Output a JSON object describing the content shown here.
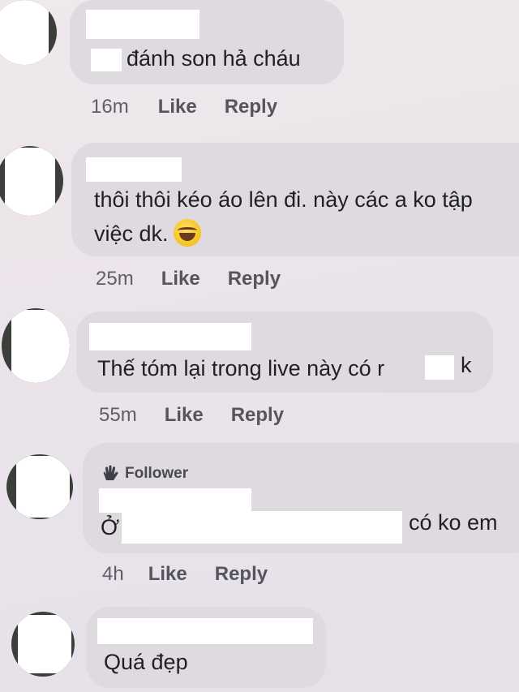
{
  "comments": [
    {
      "lines": [
        "đánh son hả cháu"
      ],
      "time": "16m",
      "like_label": "Like",
      "reply_label": "Reply"
    },
    {
      "lines": [
        "thôi thôi kéo áo lên đi. này các a ko tập",
        "việc dk."
      ],
      "emoji": "laughing-tears-emoji",
      "time": "25m",
      "like_label": "Like",
      "reply_label": "Reply"
    },
    {
      "lines": [
        "Thế tóm lại trong live này có r",
        "k"
      ],
      "time": "55m",
      "like_label": "Like",
      "reply_label": "Reply"
    },
    {
      "badge": "Follower",
      "badge_icon": "waving-hand-icon",
      "lines": [
        "Ở",
        "có ko em"
      ],
      "time": "4h",
      "like_label": "Like",
      "reply_label": "Reply"
    },
    {
      "lines": [
        "Quá đẹp"
      ]
    }
  ],
  "colors": {
    "background": "#ebe4ea",
    "bubble": "#dedae0",
    "redaction": "#ffffff",
    "meta_text": "#55555d"
  }
}
